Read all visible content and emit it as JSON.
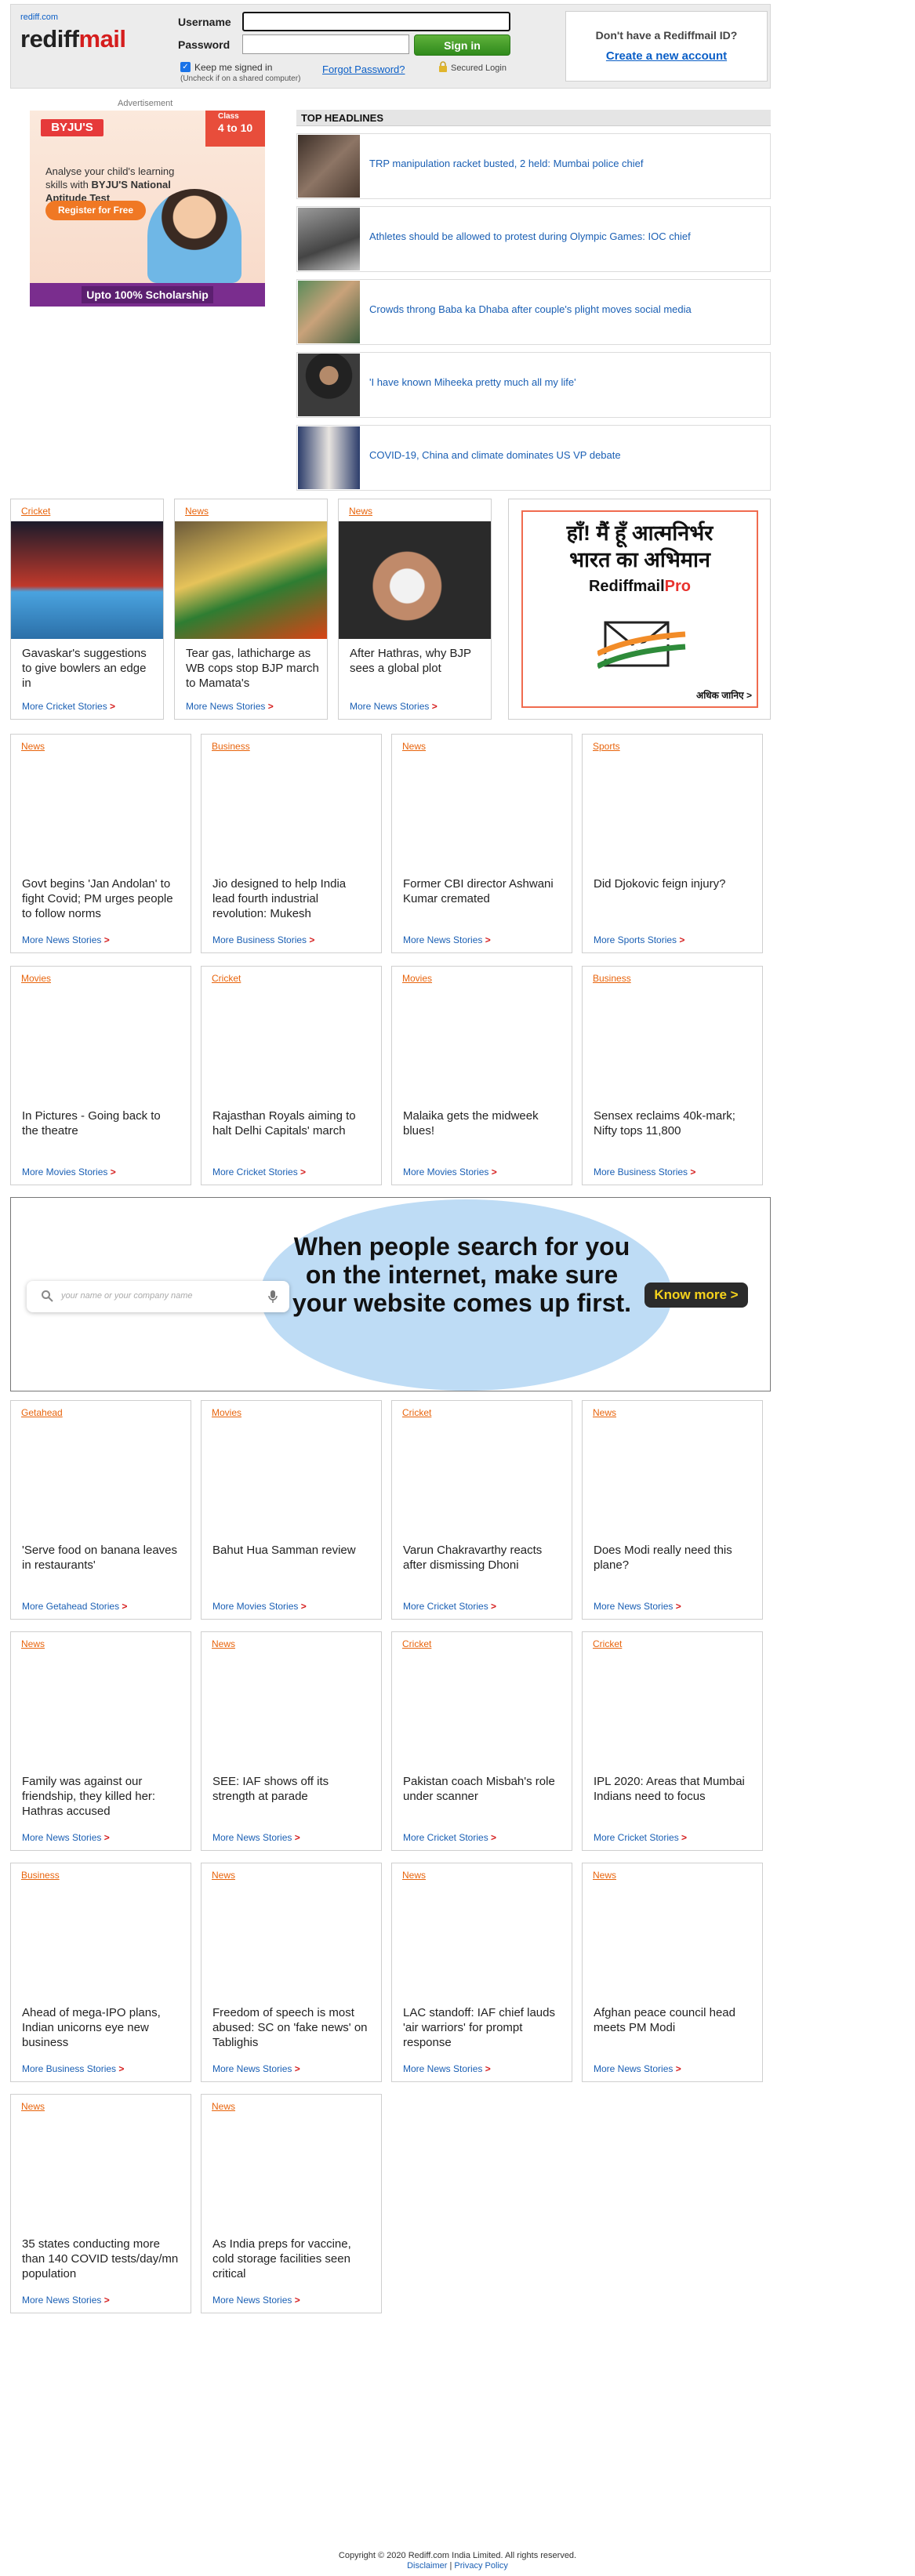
{
  "header": {
    "site_small": "rediff.com",
    "logo_part1": "rediff",
    "logo_part2": "mail",
    "username_label": "Username",
    "password_label": "Password",
    "signin_label": "Sign in",
    "keep_signed_in": "Keep me signed in",
    "keep_note": "(Uncheck if on a shared computer)",
    "forgot": "Forgot Password?",
    "secured": "Secured Login",
    "signup_question": "Don't have a Rediffmail ID?",
    "signup_link": "Create a new account"
  },
  "ad": {
    "label": "Advertisement",
    "brand": "BYJU'S",
    "age_small": "Class",
    "age": "4 to 10",
    "text_line1": "Analyse your child's learning skills with",
    "text_bold": "BYJU'S National Aptitude Test",
    "register": "Register for Free",
    "scholarship": "Upto 100% Scholarship"
  },
  "top_headlines": {
    "title": "TOP HEADLINES",
    "items": [
      {
        "text": "TRP manipulation racket busted, 2 held: Mumbai police chief"
      },
      {
        "text": "Athletes should be allowed to protest during Olympic Games: IOC chief"
      },
      {
        "text": "Crowds throng Baba ka Dhaba after couple's plight moves social media"
      },
      {
        "text": "'I have known Miheeka pretty much all my life'"
      },
      {
        "text": "COVID-19, China and climate dominates US VP debate"
      }
    ]
  },
  "photo_cards": [
    {
      "category": "Cricket",
      "headline": "Gavaskar's suggestions to give bowlers an edge in",
      "more": "More Cricket Stories"
    },
    {
      "category": "News",
      "headline": "Tear gas, lathicharge as WB cops stop BJP march to Mamata's",
      "more": "More News Stories"
    },
    {
      "category": "News",
      "headline": "After Hathras, why BJP sees a global plot",
      "more": "More News Stories"
    }
  ],
  "pro_ad": {
    "line1": "हाँ! मैं हूँ आत्मनिर्भर",
    "line2": "भारत का अभिमान",
    "brand1": "Rediffmail",
    "brand2": "Pro",
    "more": "अधिक जानिए >"
  },
  "cards": [
    {
      "category": "News",
      "headline": "Govt begins 'Jan Andolan' to fight Covid; PM urges people to follow norms",
      "more": "More News Stories"
    },
    {
      "category": "Business",
      "headline": "Jio designed to help India lead fourth industrial revolution: Mukesh",
      "more": "More Business Stories"
    },
    {
      "category": "News",
      "headline": "Former CBI director Ashwani Kumar cremated",
      "more": "More News Stories"
    },
    {
      "category": "Sports",
      "headline": "Did Djokovic feign injury?",
      "more": "More Sports Stories"
    },
    {
      "category": "Movies",
      "headline": "In Pictures - Going back to the theatre",
      "more": "More Movies Stories"
    },
    {
      "category": "Cricket",
      "headline": "Rajasthan Royals aiming to halt Delhi Capitals' march",
      "more": "More Cricket Stories"
    },
    {
      "category": "Movies",
      "headline": "Malaika gets the midweek blues!",
      "more": "More Movies Stories"
    },
    {
      "category": "Business",
      "headline": "Sensex reclaims 40k-mark; Nifty tops 11,800",
      "more": "More Business Stories"
    },
    {
      "category": "Getahead",
      "headline": "'Serve food on banana leaves in restaurants'",
      "more": "More Getahead Stories"
    },
    {
      "category": "Movies",
      "headline": "Bahut Hua Samman review",
      "more": "More Movies Stories"
    },
    {
      "category": "Cricket",
      "headline": "Varun Chakravarthy reacts after dismissing Dhoni",
      "more": "More Cricket Stories"
    },
    {
      "category": "News",
      "headline": "Does Modi really need this plane?",
      "more": "More News Stories"
    },
    {
      "category": "News",
      "headline": "Family was against our friendship, they killed her: Hathras accused",
      "more": "More News Stories"
    },
    {
      "category": "News",
      "headline": "SEE: IAF shows off its strength at parade",
      "more": "More News Stories"
    },
    {
      "category": "Cricket",
      "headline": "Pakistan coach Misbah's role under scanner",
      "more": "More Cricket Stories"
    },
    {
      "category": "Cricket",
      "headline": "IPL 2020: Areas that Mumbai Indians need to focus",
      "more": "More Cricket Stories"
    },
    {
      "category": "Business",
      "headline": "Ahead of mega-IPO plans, Indian unicorns eye new business",
      "more": "More Business Stories"
    },
    {
      "category": "News",
      "headline": "Freedom of speech is most abused: SC on 'fake news' on Tablighis",
      "more": "More News Stories"
    },
    {
      "category": "News",
      "headline": "LAC standoff: IAF chief lauds 'air warriors' for prompt response",
      "more": "More News Stories"
    },
    {
      "category": "News",
      "headline": "Afghan peace council head meets PM Modi",
      "more": "More News Stories"
    },
    {
      "category": "News",
      "headline": "35 states conducting more than 140 COVID tests/day/mn population",
      "more": "More News Stories"
    },
    {
      "category": "News",
      "headline": "As India preps for vaccine, cold storage facilities seen critical",
      "more": "More News Stories"
    }
  ],
  "banner": {
    "placeholder": "your name or your company name",
    "text": "When people search for you on the internet, make sure your website comes up first.",
    "button": "Know more >"
  },
  "footer": {
    "copyright": "Copyright © 2020 Rediff.com India Limited. All rights reserved.",
    "disclaimer": "Disclaimer",
    "sep": "|",
    "privacy": "Privacy Policy"
  }
}
